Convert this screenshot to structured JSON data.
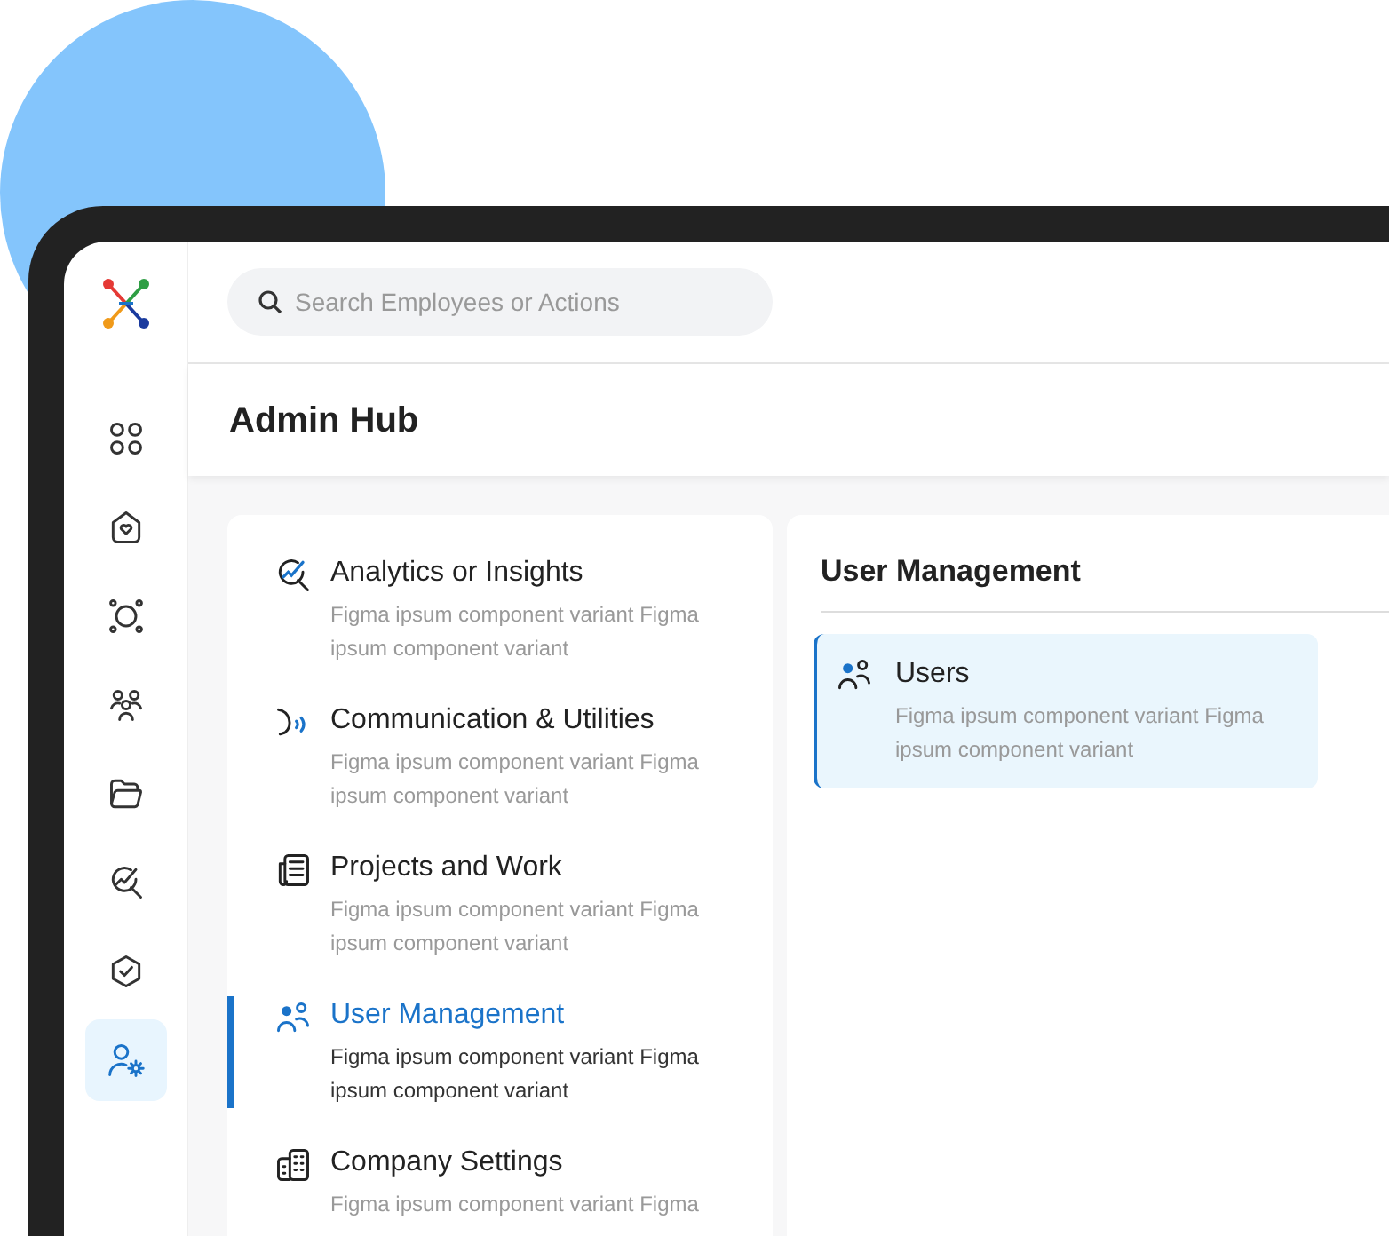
{
  "sidebar": {
    "items": [
      {
        "selected": false
      },
      {
        "selected": false
      },
      {
        "selected": false
      },
      {
        "selected": false
      },
      {
        "selected": false
      },
      {
        "selected": false
      },
      {
        "selected": false
      },
      {
        "selected": true
      }
    ]
  },
  "search": {
    "placeholder": "Search Employees or Actions"
  },
  "page_title": "Admin Hub",
  "categories": [
    {
      "title": "Analytics or Insights",
      "description": "Figma ipsum component variant Figma ipsum component variant",
      "selected": false
    },
    {
      "title": "Communication & Utilities",
      "description": "Figma ipsum component variant Figma ipsum component variant",
      "selected": false
    },
    {
      "title": "Projects and Work",
      "description": "Figma ipsum component variant Figma ipsum component variant",
      "selected": false
    },
    {
      "title": "User Management",
      "description": "Figma ipsum component variant Figma ipsum component variant",
      "selected": true
    },
    {
      "title": "Company Settings",
      "description": "Figma ipsum component variant Figma",
      "selected": false
    }
  ],
  "panel": {
    "title": "User Management",
    "items": [
      {
        "title": "Users",
        "description": "Figma ipsum component variant Figma ipsum component variant",
        "selected": true
      }
    ]
  }
}
